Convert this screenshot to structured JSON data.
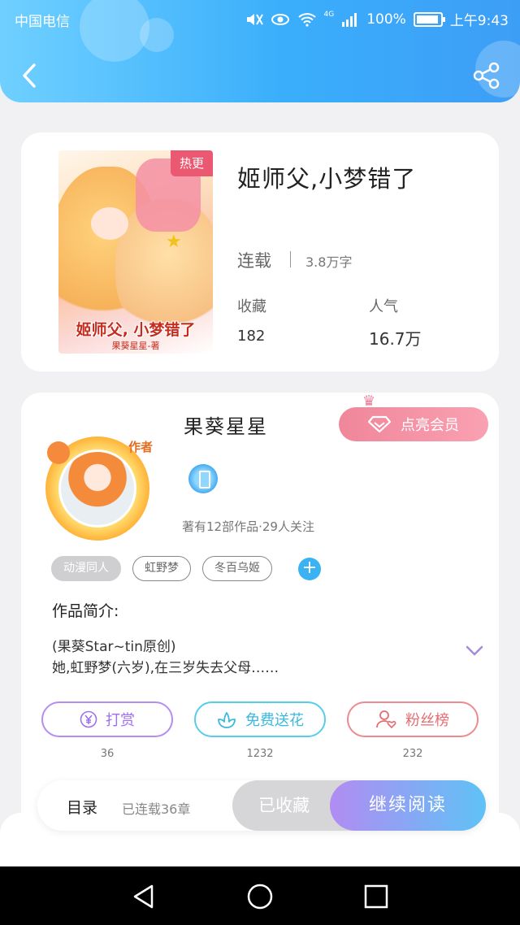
{
  "status_bar": {
    "carrier": "中国电信",
    "network": "4G",
    "battery": "100%",
    "time": "上午9:43"
  },
  "book": {
    "title": "姬师父,小梦错了",
    "hot_badge": "热更",
    "cover_title": "姬师父, 小梦错了",
    "cover_author": "果葵星星-著",
    "status": "连载",
    "word_count": "3.8万字",
    "favorites_label": "收藏",
    "favorites_value": "182",
    "popularity_label": "人气",
    "popularity_value": "16.7万"
  },
  "author": {
    "avatar_tag": "作者",
    "name": "果葵星星",
    "vip_button": "点亮会员",
    "stats": "著有12部作品·29人关注"
  },
  "tags": [
    "动漫同人",
    "虹野梦",
    "冬百乌姬"
  ],
  "intro": {
    "title": "作品简介:",
    "line1": "(果葵Star~tin原创)",
    "line2": "她,虹野梦(六岁),在三岁失去父母……"
  },
  "actions": [
    {
      "label": "打赏",
      "count": "36",
      "icon": "yen-icon",
      "color": "#9d6ff0"
    },
    {
      "label": "免费送花",
      "count": "1232",
      "icon": "flower-icon",
      "color": "#3bb8de"
    },
    {
      "label": "粉丝榜",
      "count": "232",
      "icon": "user-heart-icon",
      "color": "#e66c72"
    }
  ],
  "read_bar": {
    "toc_label": "目录",
    "toc_status": "已连载36章",
    "collected_label": "已收藏",
    "continue_label": "继续阅读"
  },
  "colors": {
    "header_gradient": [
      "#6fd0ff",
      "#3d9ef6"
    ],
    "vip_pink": "#f0869a",
    "accent_blue": "#3bb3f2"
  }
}
